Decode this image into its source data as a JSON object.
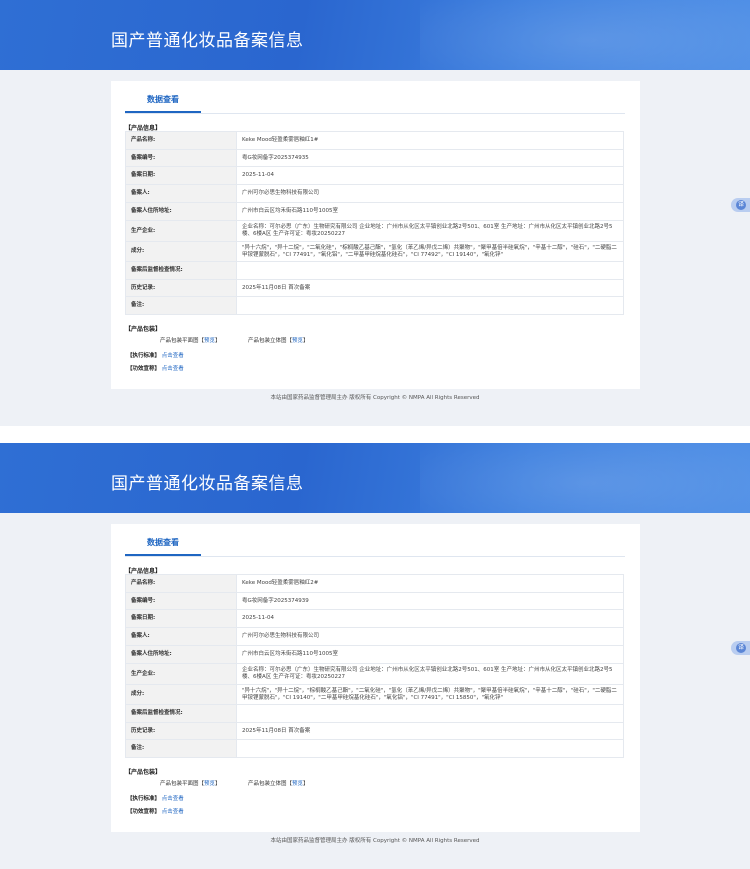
{
  "pages": [
    {
      "banner_title": "国产普通化妆品备案信息",
      "tab_label": "数据查看",
      "section_product_info": "【产品信息】",
      "rows": [
        {
          "label": "产品名称:",
          "value": "Keke Mood轻盈柔雾唇釉红1#"
        },
        {
          "label": "备案编号:",
          "value": "粤G妆网备字2025374935"
        },
        {
          "label": "备案日期:",
          "value": "2025-11-04"
        },
        {
          "label": "备案人:",
          "value": "广州可尔必思生物科技有限公司"
        },
        {
          "label": "备案人住所地址:",
          "value": "广州市白云区均禾街石路110号1005室"
        },
        {
          "label": "生产企业:",
          "value": "企业名称：可尔必思（广东）生物研究有限公司 企业地址：广州市从化区太平镇创业北路2号501、601室 生产地址：广州市从化区太平镇创业北路2号5楼、6楼A区 生产许可证：粤妆20250227"
        },
        {
          "label": "成分:",
          "value": "\"异十六烷\"，\"异十二烷\"，\"二氧化硅\"，\"棕榈酸乙基己酯\"，\"氢化（苯乙烯/异戊二烯）共聚物\"，\"聚甲基倍半硅氧烷\"，\"辛基十二醇\"，\"硅石\"，\"二硬脂二甲铵锂蒙脱石\"，\"CI 77491\"，\"氧化铝\"，\"二甲基甲硅烷基化硅石\"，\"CI 77492\"，\"CI 19140\"，\"氧化锌\""
        },
        {
          "label": "备案后监督检查情况:",
          "value": ""
        },
        {
          "label": "历史记录:",
          "value": "2025年11月08日 首次备案"
        },
        {
          "label": "备注:",
          "value": ""
        }
      ],
      "section_packaging": "【产品包装】",
      "pkg_flat_label": "产品包装平面图",
      "pkg_3d_label": "产品包装立体图",
      "bracket_open": "【",
      "bracket_close": "】",
      "preview_link": "预览",
      "standard_label": "【执行标准】",
      "efficacy_label": "【功效宣称】",
      "view_link": "点击查看",
      "footer": "本站由国家药品监督管理局主办 版权所有 Copyright © NMPA All Rights Reserved",
      "side_widget_icon": "译"
    },
    {
      "banner_title": "国产普通化妆品备案信息",
      "tab_label": "数据查看",
      "section_product_info": "【产品信息】",
      "rows": [
        {
          "label": "产品名称:",
          "value": "Keke Mood轻盈柔雾唇釉红2#"
        },
        {
          "label": "备案编号:",
          "value": "粤G妆网备字2025374939"
        },
        {
          "label": "备案日期:",
          "value": "2025-11-04"
        },
        {
          "label": "备案人:",
          "value": "广州可尔必思生物科技有限公司"
        },
        {
          "label": "备案人住所地址:",
          "value": "广州市白云区均禾街石路110号1005室"
        },
        {
          "label": "生产企业:",
          "value": "企业名称：可尔必思（广东）生物研究有限公司 企业地址：广州市从化区太平镇创业北路2号501、601室 生产地址：广州市从化区太平镇创业北路2号5楼、6楼A区 生产许可证：粤妆20250227"
        },
        {
          "label": "成分:",
          "value": "\"异十六烷\"，\"异十二烷\"，\"棕榈酸乙基己酯\"，\"二氧化硅\"，\"氢化（苯乙烯/异戊二烯）共聚物\"，\"聚甲基倍半硅氧烷\"，\"辛基十二醇\"，\"硅石\"，\"二硬脂二甲铵锂蒙脱石\"，\"CI 19140\"，\"二甲基甲硅烷基化硅石\"，\"氧化铝\"，\"CI 77491\"，\"CI 15850\"，\"氧化锌\""
        },
        {
          "label": "备案后监督检查情况:",
          "value": ""
        },
        {
          "label": "历史记录:",
          "value": "2025年11月08日 首次备案"
        },
        {
          "label": "备注:",
          "value": ""
        }
      ],
      "section_packaging": "【产品包装】",
      "pkg_flat_label": "产品包装平面图",
      "pkg_3d_label": "产品包装立体图",
      "bracket_open": "【",
      "bracket_close": "】",
      "preview_link": "预览",
      "standard_label": "【执行标准】",
      "efficacy_label": "【功效宣称】",
      "view_link": "点击查看",
      "footer": "本站由国家药品监督管理局主办 版权所有 Copyright © NMPA All Rights Reserved",
      "side_widget_icon": "译"
    }
  ]
}
